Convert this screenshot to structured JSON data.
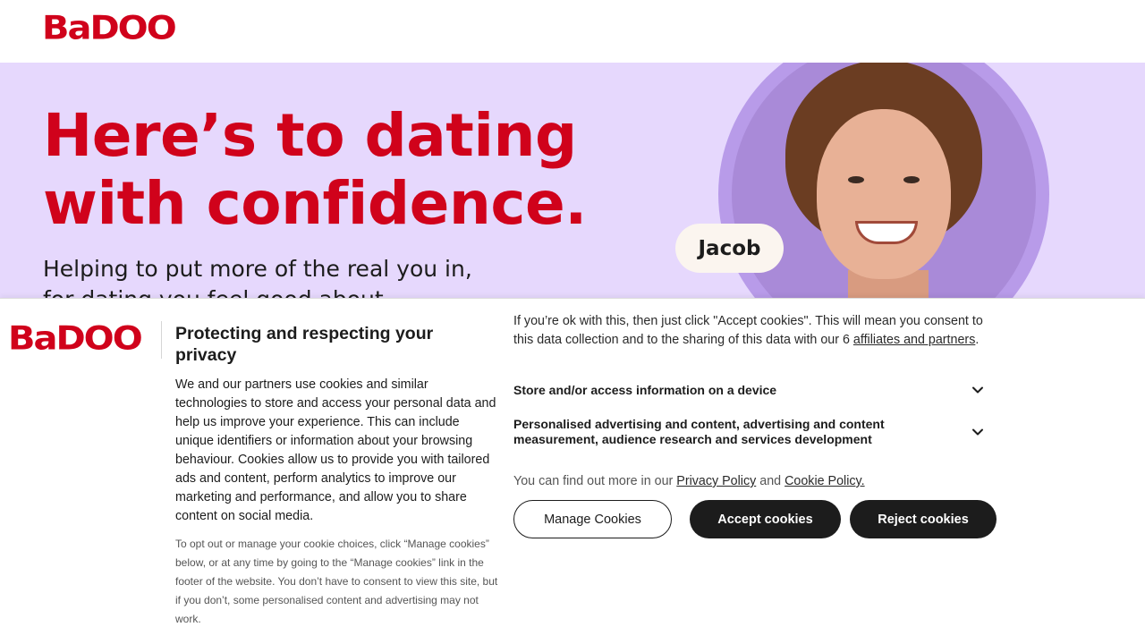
{
  "header": {
    "logo_text": "BaDOO"
  },
  "hero": {
    "title_line1": "Here’s to dating",
    "title_line2": "with confidence.",
    "subtitle_line1": "Helping to put more of the real you in,",
    "subtitle_line2": "for dating you feel good about.",
    "profile_name": "Jacob",
    "colors": {
      "background": "#e6d8fd",
      "accent": "#d0021b"
    }
  },
  "cookie_banner": {
    "logo_text": "BaDOO",
    "title": "Protecting and respecting your privacy",
    "body": "We and our partners use cookies and similar technologies to store and access your personal data and help us improve your experience. This can include unique identifiers or information about your browsing behaviour. Cookies allow us to provide you with tailored ads and content, perform analytics to improve our marketing and performance, and allow you to share content on social media.",
    "small_print": "To opt out or manage your cookie choices, click “Manage cookies” below, or at any time by going to the “Manage cookies” link in the footer of the website. You don’t have to consent to view this site, but if you don’t, some personalised content and advertising may not work.",
    "intro_text": "If you’re ok with this, then just click \"Accept cookies\". This will mean you consent to this data collection and to the sharing of this data with our 6 ",
    "affiliates_link": "affiliates and partners",
    "intro_end": ".",
    "purposes": [
      {
        "label": "Store and/or access information on a device",
        "icon": "chevron-down-icon"
      },
      {
        "label": "Personalised advertising and content, advertising and content measurement, audience research and services development",
        "icon": "chevron-down-icon"
      }
    ],
    "policy_prefix": "You can find out more in our ",
    "privacy_policy_link": "Privacy Policy",
    "policy_and": " and ",
    "cookie_policy_link": "Cookie Policy.",
    "buttons": {
      "manage": "Manage Cookies",
      "accept": "Accept cookies",
      "reject": "Reject cookies"
    }
  }
}
